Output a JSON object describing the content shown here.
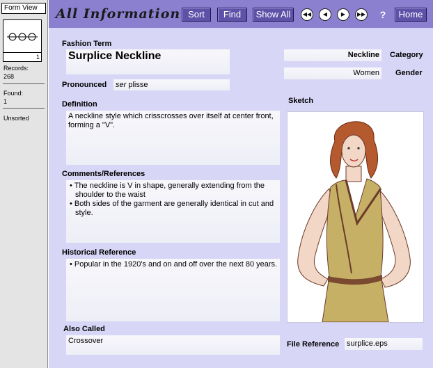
{
  "status": {
    "layout": "Form View",
    "book_page": "1",
    "records_label": "Records:",
    "records_value": "268",
    "found_label": "Found:",
    "found_value": "1",
    "sort_state": "Unsorted"
  },
  "header": {
    "title": "All Information",
    "buttons": {
      "sort": "Sort",
      "find": "Find",
      "show_all": "Show All",
      "help": "?",
      "home": "Home"
    },
    "nav_icons": [
      "first-record-icon",
      "previous-record-icon",
      "next-record-icon",
      "last-record-icon"
    ]
  },
  "form": {
    "fashion_term_label": "Fashion Term",
    "fashion_term": "Surplice Neckline",
    "pronounced_label": "Pronounced",
    "pronounced_italic": "ser",
    "pronounced_rest": "plisse",
    "category_label": "Category",
    "category": "Neckline",
    "gender_label": "Gender",
    "gender": "Women",
    "definition_label": "Definition",
    "definition": "A neckline style which crisscrosses over itself at center front, forming a \"V\".",
    "comments_label": "Comments/References",
    "comments": [
      "The neckline is V in shape, generally extending from the shoulder to the waist",
      "Both sides of the garment are generally identical in cut and style."
    ],
    "historical_label": "Historical Reference",
    "historical": [
      "Popular in the 1920's and on and off over the next 80 years."
    ],
    "also_called_label": "Also Called",
    "also_called": "Crossover",
    "sketch_label": "Sketch",
    "file_reference_label": "File Reference",
    "file_reference": "surplice.eps"
  },
  "colors": {
    "header_bg": "#8b7fd0",
    "panel_bg": "#d8d6f6",
    "button_bg": "#5d52a8",
    "dress": "#c6b066",
    "hair": "#b55a2e"
  }
}
